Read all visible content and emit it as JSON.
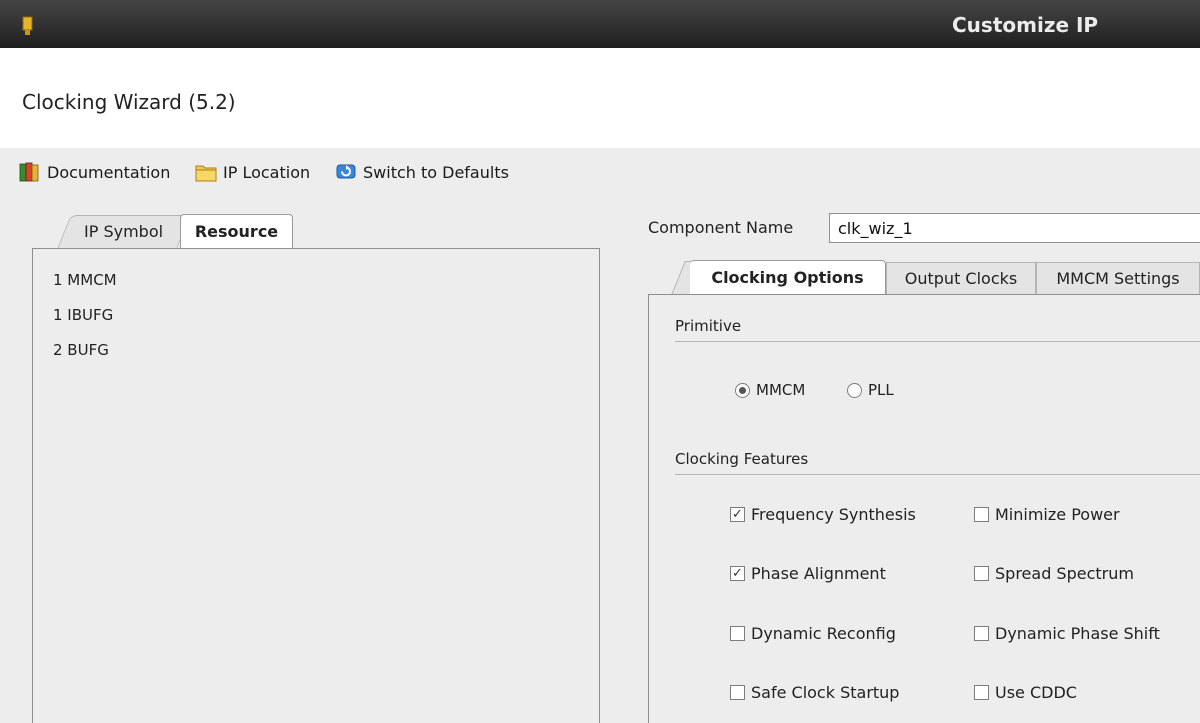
{
  "window": {
    "title": "Customize IP"
  },
  "wizard": {
    "title": "Clocking Wizard (5.2)"
  },
  "toolbar": {
    "documentation": "Documentation",
    "ip_location": "IP Location",
    "switch_defaults": "Switch to Defaults"
  },
  "left_tabs": [
    {
      "label": "IP Symbol",
      "active": false
    },
    {
      "label": "Resource",
      "active": true
    }
  ],
  "resources": [
    "1 MMCM",
    "1 IBUFG",
    "2 BUFG"
  ],
  "component": {
    "label": "Component Name",
    "value": "clk_wiz_1"
  },
  "right_tabs": [
    {
      "label": "Clocking Options",
      "active": true
    },
    {
      "label": "Output Clocks",
      "active": false
    },
    {
      "label": "MMCM Settings",
      "active": false
    }
  ],
  "primitive": {
    "title": "Primitive",
    "options": [
      {
        "label": "MMCM",
        "selected": true
      },
      {
        "label": "PLL",
        "selected": false
      }
    ]
  },
  "clocking_features": {
    "title": "Clocking Features",
    "items": [
      {
        "label": "Frequency Synthesis",
        "checked": true
      },
      {
        "label": "Minimize Power",
        "checked": false
      },
      {
        "label": "Phase Alignment",
        "checked": true
      },
      {
        "label": "Spread Spectrum",
        "checked": false
      },
      {
        "label": "Dynamic Reconfig",
        "checked": false
      },
      {
        "label": "Dynamic Phase Shift",
        "checked": false
      },
      {
        "label": "Safe Clock Startup",
        "checked": false
      },
      {
        "label": "Use CDDC",
        "checked": false
      }
    ]
  },
  "icons": {
    "documentation": "books-icon",
    "ip_location": "folder-icon",
    "switch_defaults": "refresh-icon",
    "window": "app-icon"
  }
}
